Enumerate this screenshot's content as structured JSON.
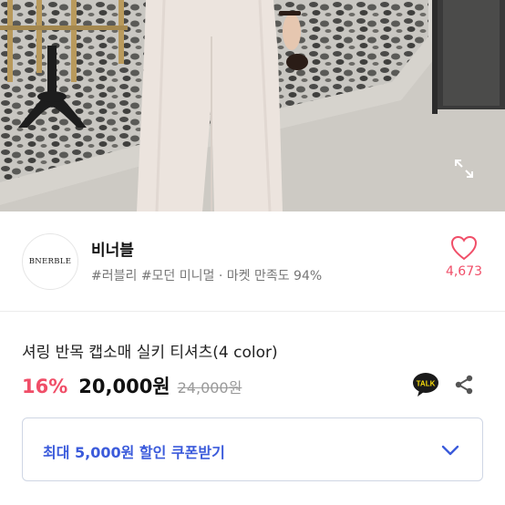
{
  "hero": {
    "image": "product-photo",
    "expand_icon": "expand-icon"
  },
  "store": {
    "logo_text": "BNERBLE",
    "name": "비너블",
    "tags": "#러블리 #모던 미니멀 · 마켓 만족도 94%",
    "like_icon": "heart-outline-icon",
    "like_count": "4,673",
    "colors": {
      "accent": "#f04e68"
    }
  },
  "product": {
    "title": "셔링 반목 캡소매 실키 티셔츠(4 color)",
    "discount": "16%",
    "price": "20,000원",
    "original_price": "24,000원",
    "talk_label": "TALK",
    "share_icon": "share-icon"
  },
  "coupon": {
    "label": "최대 5,000원 할인 쿠폰받기",
    "chevron_icon": "chevron-down-icon",
    "color": "#3b5bdb"
  }
}
